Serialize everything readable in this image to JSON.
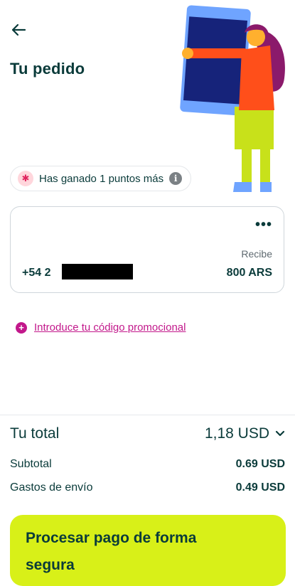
{
  "header": {
    "back_icon": "arrow-left-icon",
    "title": "Tu pedido"
  },
  "points_badge": {
    "icon": "star-badge-icon",
    "text": "Has ganado 1 puntos más",
    "info_icon": "info-icon",
    "info_glyph": "i"
  },
  "order_card": {
    "menu_label": "•••",
    "recipient_phone_prefix": "+54 2",
    "receive_label": "Recibe",
    "receive_amount": "800 ARS"
  },
  "promo": {
    "icon": "plus-circle-icon",
    "plus_glyph": "+",
    "link_text": "Introduce tu código promocional"
  },
  "summary": {
    "total_label": "Tu total",
    "total_value": "1,18 USD",
    "subtotal_label": "Subtotal",
    "subtotal_value": "0.69 USD",
    "shipping_label": "Gastos de envío",
    "shipping_value": "0.49 USD"
  },
  "cta": {
    "label": "Procesar pago de forma segura"
  },
  "colors": {
    "primary_text": "#0a3b3a",
    "accent_lime": "#d8f018",
    "link_magenta": "#c2188b"
  }
}
